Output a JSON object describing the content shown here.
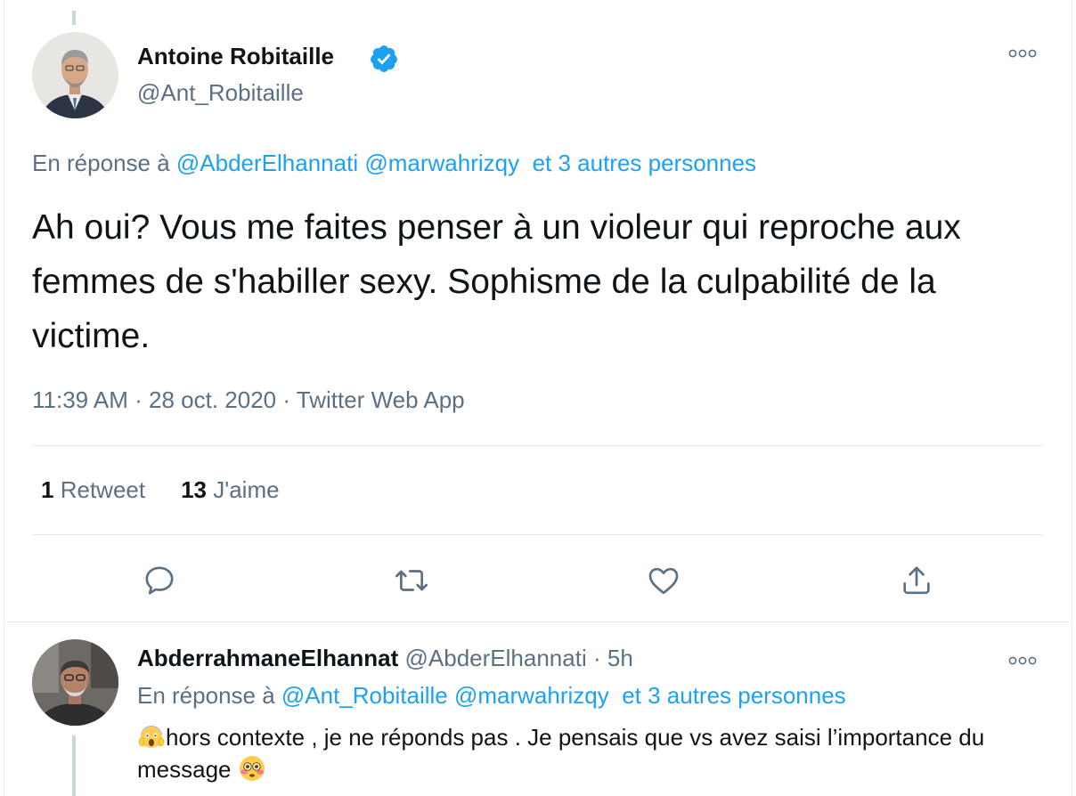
{
  "main_tweet": {
    "author_name": "Antoine Robitaille",
    "handle": "@Ant_Robitaille",
    "reply_prefix": "En réponse à",
    "reply_mentions": [
      "@AbderElhannati",
      "@marwahrizqy"
    ],
    "reply_others": "et 3 autres personnes",
    "text": "Ah oui? Vous me faites penser à un violeur qui reproche aux femmes de s'habiller sexy. Sophisme de la culpabilité de la victime.",
    "timestamp": "11:39 AM · 28 oct. 2020 · Twitter Web App",
    "stats": {
      "retweets_count": "1",
      "retweets_label": "Retweet",
      "likes_count": "13",
      "likes_label": "J'aime"
    },
    "actions": [
      "reply-icon",
      "retweet-icon",
      "like-icon",
      "share-icon"
    ]
  },
  "reply_tweet": {
    "author_name": "AbderrahmaneElhannat",
    "handle": "@AbderElhannati",
    "separator": "·",
    "time": "5h",
    "reply_prefix": "En réponse à",
    "reply_mentions": [
      "@Ant_Robitaille",
      "@marwahrizqy"
    ],
    "reply_others": "et 3 autres personnes",
    "text": "hors contexte , je ne réponds pas . Je pensais que vs avez saisi l’importance du message",
    "leading_emoji": "screaming-face-emoji",
    "trailing_emoji": "flushed-face-emoji"
  },
  "colors": {
    "accent": "#1da1f2",
    "text_primary": "#0f1419",
    "text_secondary": "#5b7083",
    "divider": "#e1e8ed",
    "thread_line": "#ccd6dd"
  }
}
